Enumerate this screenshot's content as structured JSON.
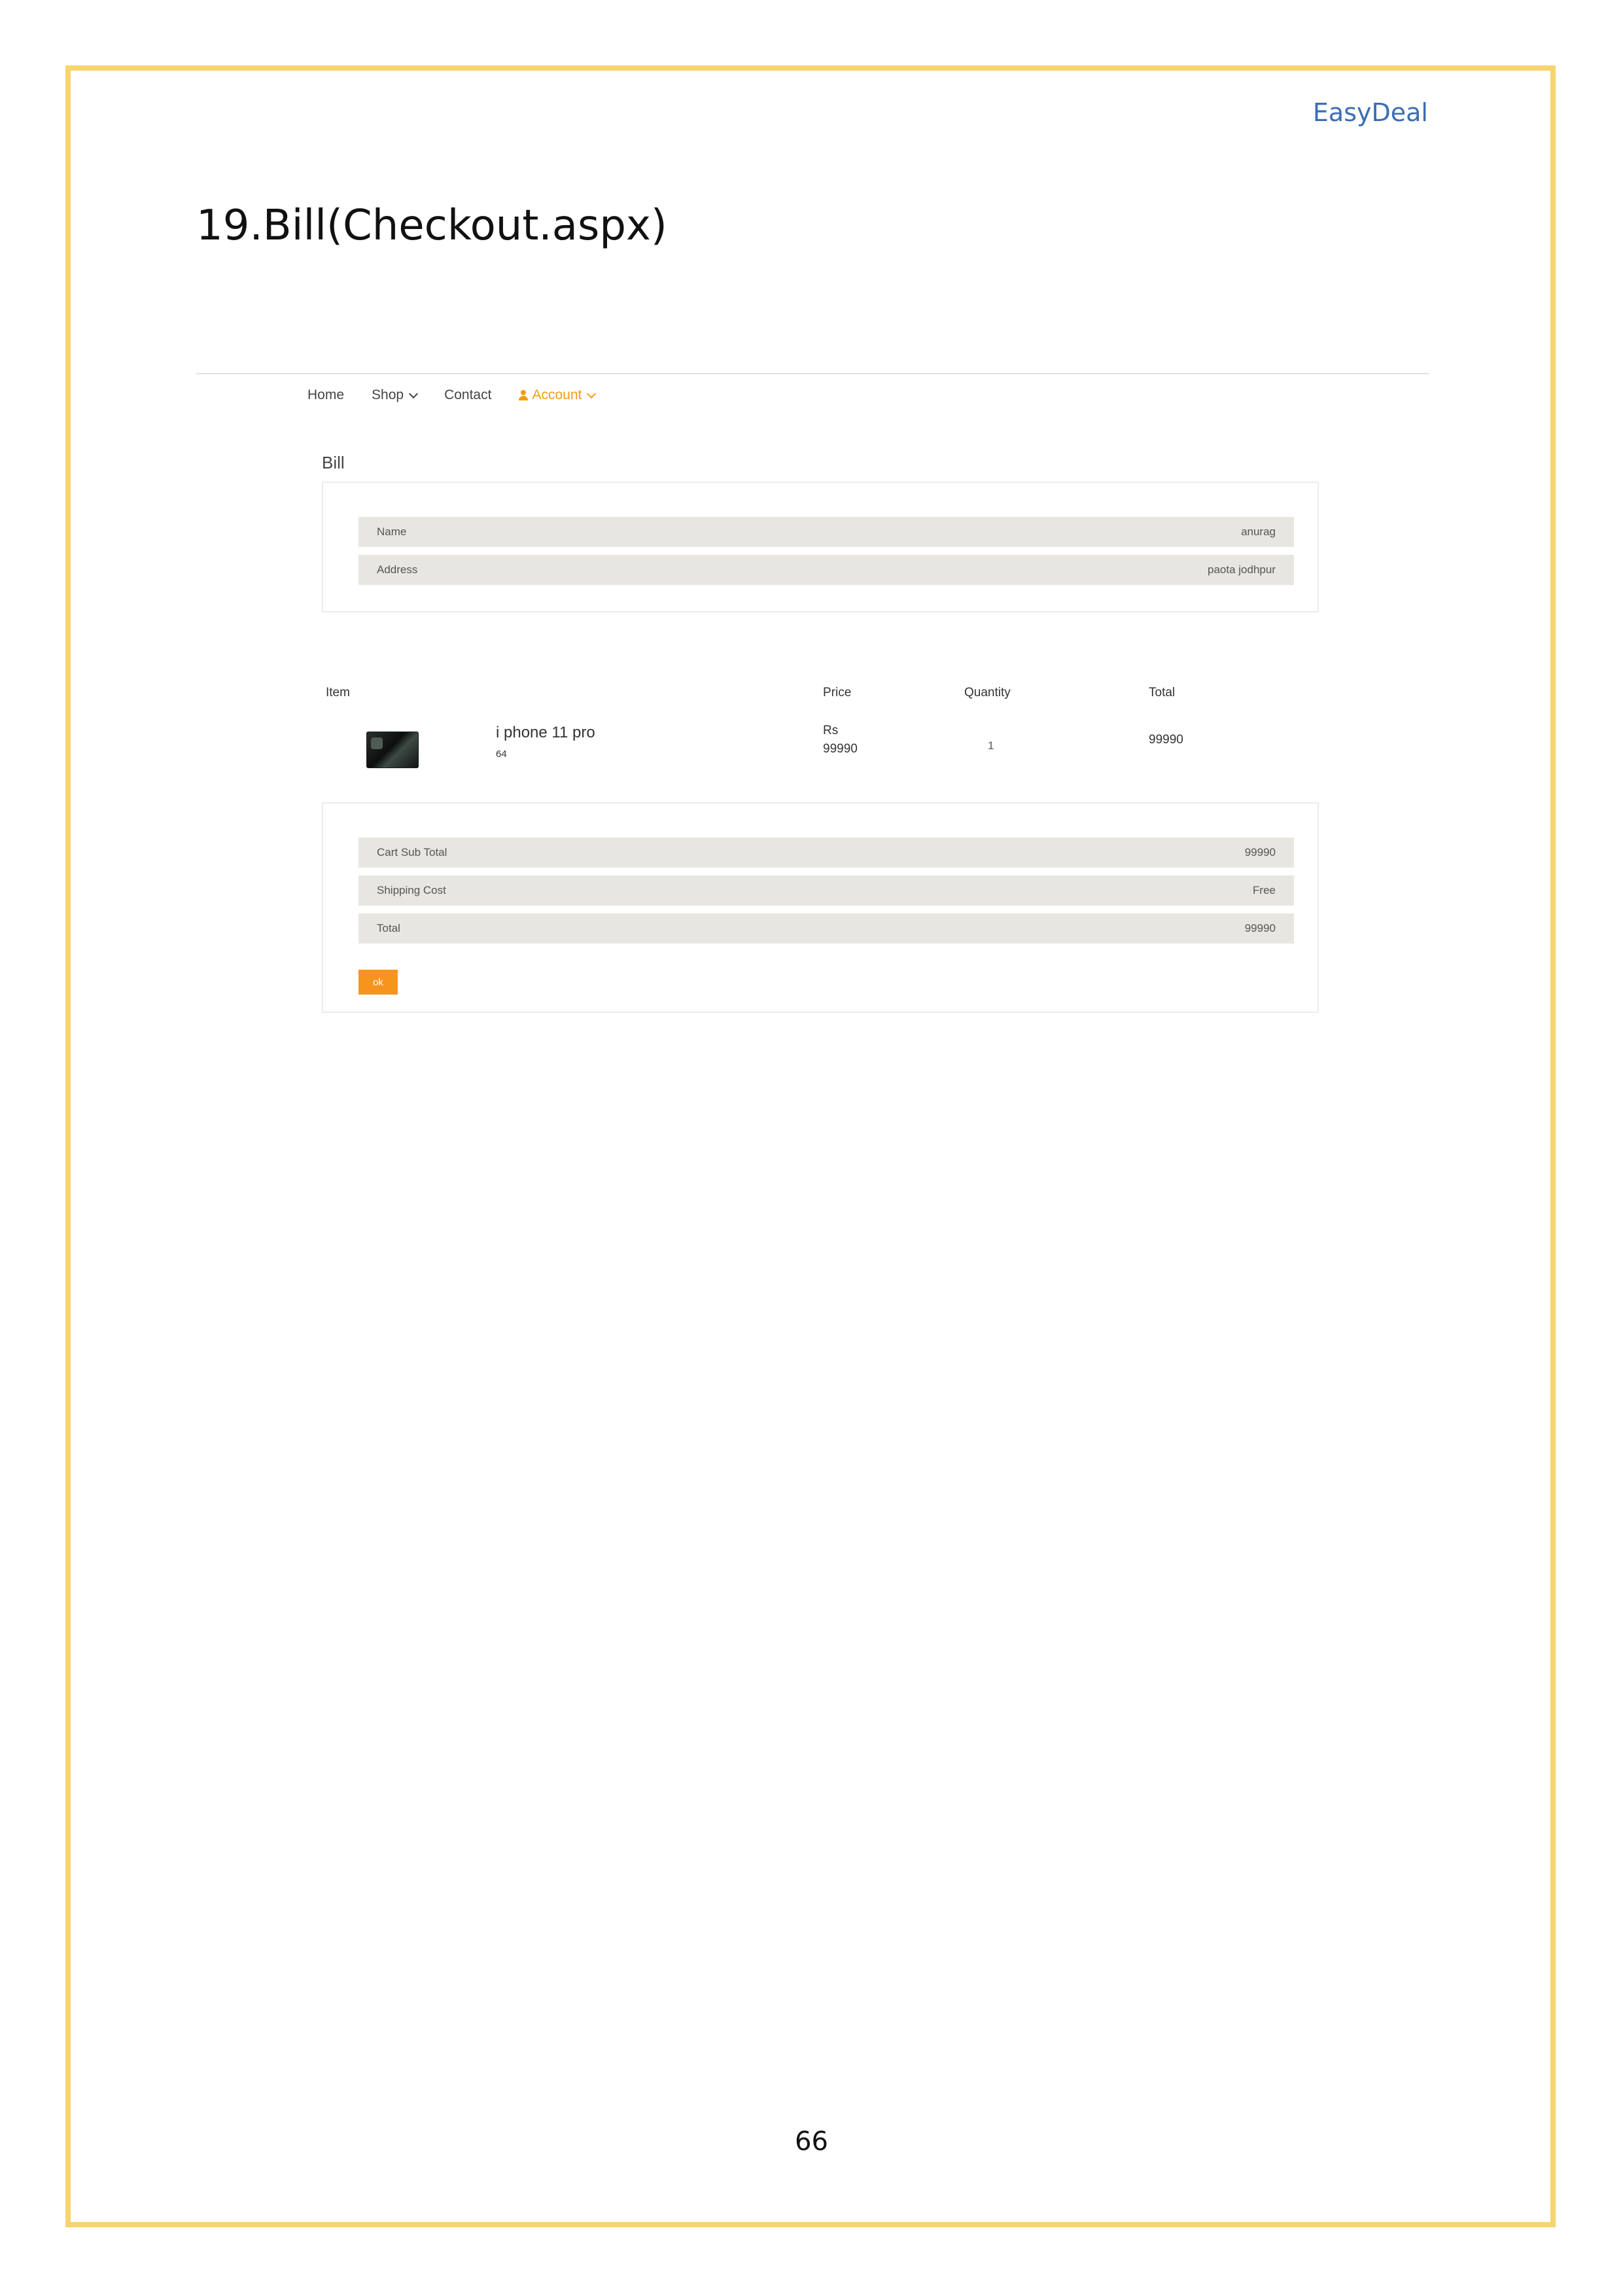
{
  "document": {
    "brand": "EasyDeal",
    "section_title": "19.Bill(Checkout.aspx)",
    "page_number": "66"
  },
  "nav": {
    "items": [
      {
        "label": "Home"
      },
      {
        "label": "Shop"
      },
      {
        "label": "Contact"
      },
      {
        "label": "Account"
      }
    ]
  },
  "bill": {
    "heading": "Bill",
    "customer": [
      {
        "label": "Name",
        "value": "anurag"
      },
      {
        "label": "Address",
        "value": "paota jodhpur"
      }
    ]
  },
  "cart": {
    "headers": {
      "item": "Item",
      "price": "Price",
      "quantity": "Quantity",
      "total": "Total"
    },
    "items": [
      {
        "name": "i phone 11 pro",
        "variant": "64",
        "price_currency": "Rs",
        "price_value": "99990",
        "quantity": "1",
        "total": "99990"
      }
    ]
  },
  "summary": {
    "rows": [
      {
        "label": "Cart Sub Total",
        "value": "99990"
      },
      {
        "label": "Shipping Cost",
        "value": "Free"
      },
      {
        "label": "Total",
        "value": "99990"
      }
    ],
    "button_label": "ok"
  },
  "colors": {
    "page_border": "#f6d46e",
    "brand": "#3b6db3",
    "accent": "#f39c12",
    "row_bg": "#e7e6e1"
  },
  "icons": {
    "account": "user-icon",
    "dropdown": "chevron-down-icon"
  }
}
